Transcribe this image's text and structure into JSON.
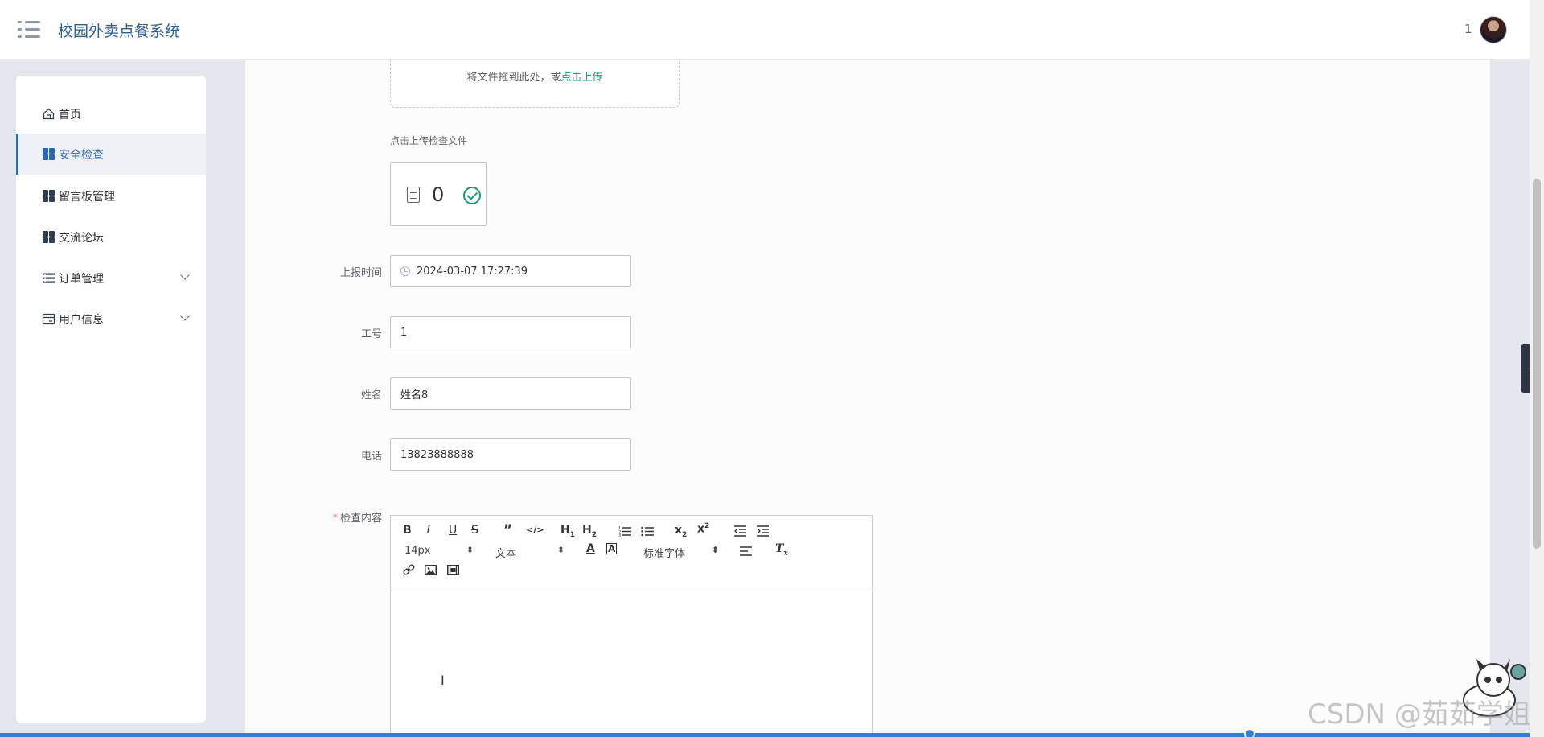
{
  "header": {
    "app_title": "校园外卖点餐系统",
    "user_name": "1"
  },
  "sidebar": {
    "items": [
      {
        "label": "首页",
        "icon": "home-icon"
      },
      {
        "label": "安全检查",
        "icon": "grid-icon",
        "active": true
      },
      {
        "label": "留言板管理",
        "icon": "grid-icon"
      },
      {
        "label": "交流论坛",
        "icon": "grid-icon"
      },
      {
        "label": "订单管理",
        "icon": "list-icon",
        "expandable": true
      },
      {
        "label": "用户信息",
        "icon": "card-icon",
        "expandable": true
      }
    ]
  },
  "upload": {
    "drop_text": "将文件拖到此处，或",
    "drop_link": "点击上传",
    "hint": "点击上传检查文件",
    "file_count": "0"
  },
  "form": {
    "report_time": {
      "label": "上报时间",
      "value": "2024-03-07 17:27:39"
    },
    "employee_id": {
      "label": "工号",
      "value": "1"
    },
    "name": {
      "label": "姓名",
      "value": "姓名8"
    },
    "phone": {
      "label": "电话",
      "value": "13823888888"
    },
    "content": {
      "label": "检查内容",
      "required": true
    }
  },
  "editor": {
    "font_size": "14px",
    "header_type": "文本",
    "font_family": "标准字体",
    "buttons": [
      "B",
      "I",
      "U",
      "S",
      "❞",
      "</>",
      "H1",
      "H2",
      "ol",
      "ul",
      "x₂",
      "x²",
      "outdent",
      "indent",
      "A",
      "bg",
      "align",
      "clean",
      "link",
      "image",
      "video"
    ]
  },
  "watermark": "CSDN @茹茹学姐",
  "colors": {
    "accent": "#2c6aa8",
    "link": "#16a07a",
    "required": "#f56c6c"
  }
}
